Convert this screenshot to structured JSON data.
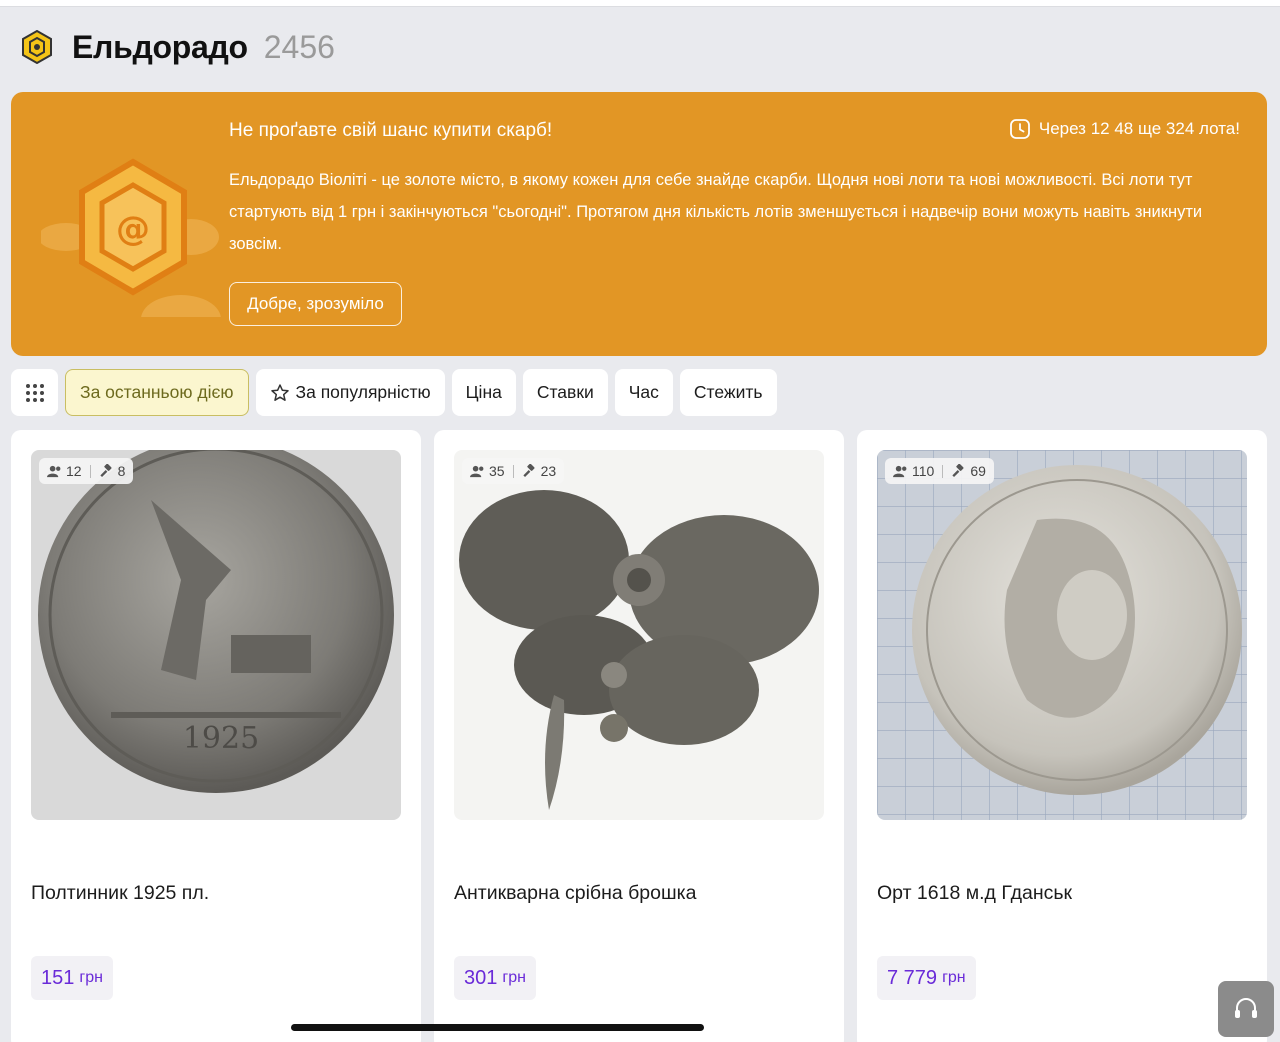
{
  "header": {
    "title": "Ельдорадо",
    "count": "2456"
  },
  "banner": {
    "headline": "Не проґавте свій шанс купити скарб!",
    "timer_text": "Через 12 48 ще 324 лота!",
    "description": "Ельдорадо Віоліті - це золоте місто, в якому кожен для себе знайде скарби. Щодня нові лоти та нові можливості. Всі лоти тут стартують від 1 грн і закінчуються \"сьогодні\". Протягом дня кількість лотів зменшується і надвечір вони можуть навіть зникнути зовсім.",
    "button_label": "Добре, зрозуміло",
    "background_color": "#e29625"
  },
  "filters": [
    {
      "label": "За останньою дією",
      "active": true
    },
    {
      "label": "За популярністю",
      "active": false,
      "icon": "star-icon"
    },
    {
      "label": "Ціна",
      "active": false
    },
    {
      "label": "Ставки",
      "active": false
    },
    {
      "label": "Час",
      "active": false
    },
    {
      "label": "Стежить",
      "active": false
    }
  ],
  "lots": [
    {
      "title": "Полтинник 1925 пл.",
      "watchers": "12",
      "bids": "8",
      "price": "151",
      "currency": "грн",
      "image": "silver-coin-1925"
    },
    {
      "title": "Антикварна срібна брошка",
      "watchers": "35",
      "bids": "23",
      "price": "301",
      "currency": "грн",
      "image": "silver-filigree-brooch"
    },
    {
      "title": "Орт 1618 м.д Гданськ",
      "watchers": "110",
      "bids": "69",
      "price": "7 779",
      "currency": "грн",
      "image": "silver-coin-sigismund"
    }
  ],
  "accent_colors": {
    "price": "#6a2bd8",
    "active_chip": "#fbf6cf"
  }
}
